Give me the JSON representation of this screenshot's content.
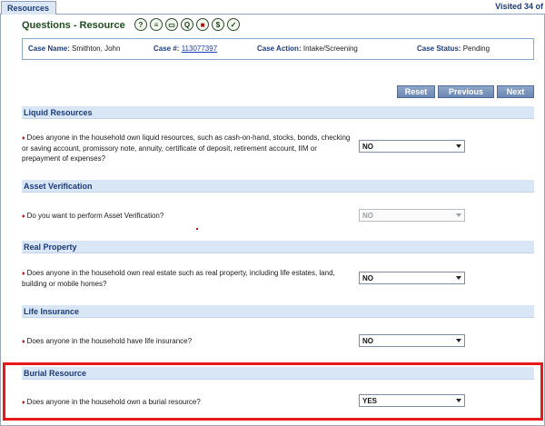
{
  "tabs": {
    "active_label": "Resources",
    "visited_text": "Visited 34 of"
  },
  "header": {
    "title": "Questions - Resource",
    "icons": [
      "help-icon",
      "document-icon",
      "folder-icon",
      "search-icon",
      "stop-icon",
      "dollar-icon",
      "checklist-icon"
    ],
    "icon_glyphs": [
      "?",
      "≡",
      "▭",
      "Q",
      "■",
      "$",
      "✓"
    ]
  },
  "case": {
    "name_label": "Case Name:",
    "name_value": "Smithton, John",
    "number_label": "Case #:",
    "number_value": "113077397",
    "action_label": "Case Action:",
    "action_value": "Intake/Screening",
    "status_label": "Case Status:",
    "status_value": "Pending"
  },
  "buttons": {
    "reset": "Reset",
    "previous": "Previous",
    "next": "Next"
  },
  "sections": {
    "liquid": {
      "title": "Liquid Resources",
      "question": "Does anyone in the household own liquid resources, such as cash-on-hand, stocks, bonds, checking or saving account, promissory note, annuity, certificate of deposit, retirement account, IIM or prepayment of expenses?",
      "value": "NO"
    },
    "asset": {
      "title": "Asset Verification",
      "question": "Do you want to perform Asset Verification?",
      "value": "NO"
    },
    "real": {
      "title": "Real Property",
      "question": "Does anyone in the household own real estate such as real property, including life estates, land, building or mobile homes?",
      "value": "NO"
    },
    "life": {
      "title": "Life Insurance",
      "question": "Does anyone in the household have life insurance?",
      "value": "NO"
    },
    "burial": {
      "title": "Burial Resource",
      "question": "Does anyone in the household own a burial resource?",
      "value": "YES"
    }
  },
  "colors": {
    "highlight": "#e8191b",
    "section_bar": "#d9e6f5",
    "button": "#7a93bd",
    "title": "#1f4d1f"
  }
}
